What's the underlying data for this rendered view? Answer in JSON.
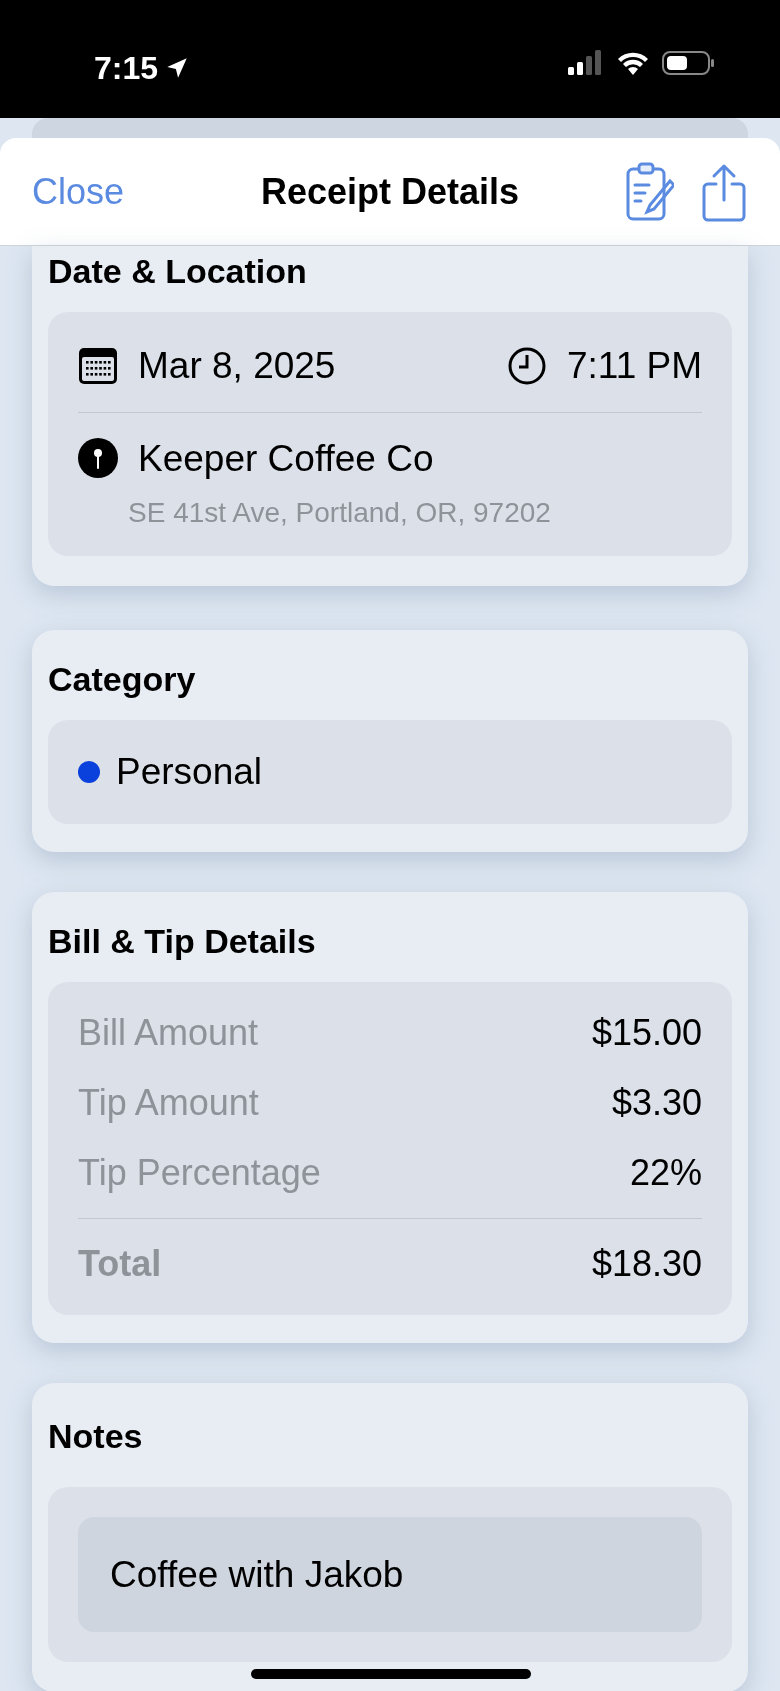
{
  "status_bar": {
    "time": "7:15",
    "location_active": true
  },
  "nav": {
    "close": "Close",
    "title": "Receipt Details"
  },
  "date_location": {
    "title": "Date & Location",
    "date": "Mar 8, 2025",
    "time": "7:11 PM",
    "place": "Keeper Coffee Co",
    "address": "SE 41st Ave, Portland, OR, 97202"
  },
  "category": {
    "title": "Category",
    "name": "Personal",
    "color": "#0a40dc"
  },
  "bill": {
    "title": "Bill & Tip Details",
    "rows": [
      {
        "label": "Bill Amount",
        "value": "$15.00"
      },
      {
        "label": "Tip Amount",
        "value": "$3.30"
      },
      {
        "label": "Tip Percentage",
        "value": "22%"
      }
    ],
    "total": {
      "label": "Total",
      "value": "$18.30"
    }
  },
  "notes": {
    "title": "Notes",
    "text": "Coffee with Jakob"
  }
}
